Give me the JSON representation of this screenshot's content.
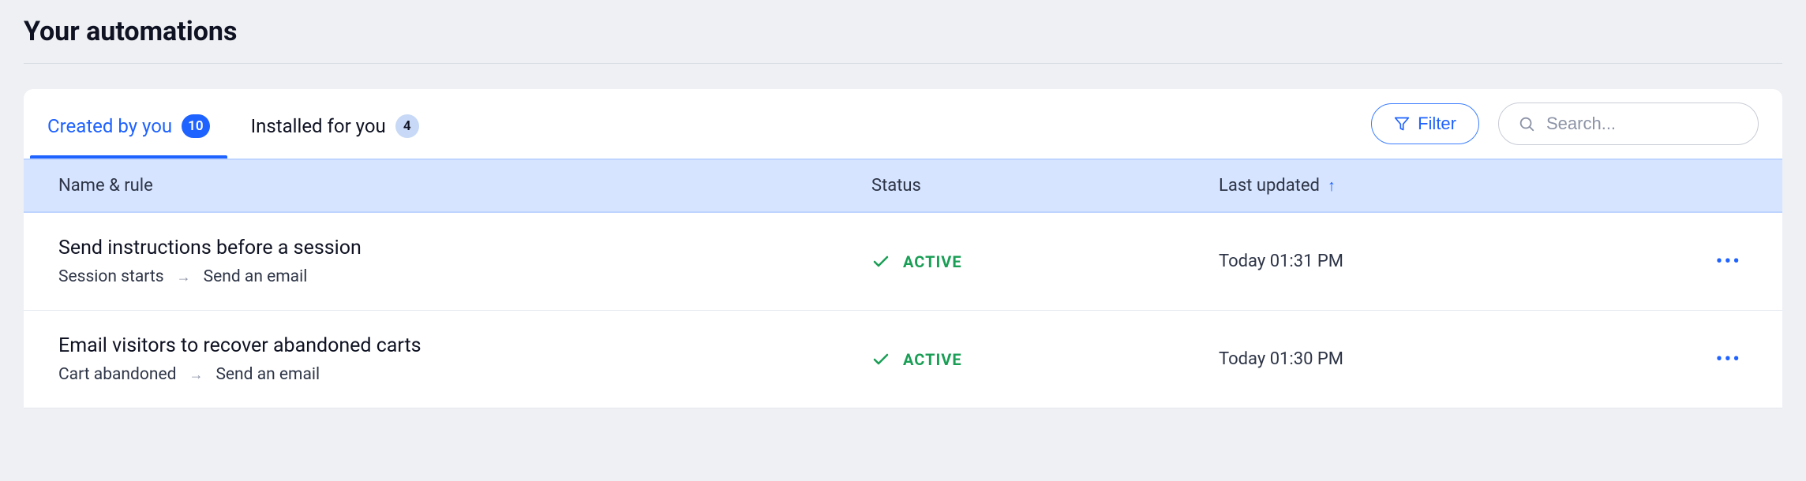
{
  "page_title": "Your automations",
  "tabs": {
    "created": {
      "label": "Created by you",
      "count": "10"
    },
    "installed": {
      "label": "Installed for you",
      "count": "4"
    }
  },
  "actions": {
    "filter_label": "Filter",
    "search_placeholder": "Search..."
  },
  "columns": {
    "name": "Name & rule",
    "status": "Status",
    "updated": "Last updated"
  },
  "rows": [
    {
      "title": "Send instructions before a session",
      "trigger": "Session starts",
      "action": "Send an email",
      "status": "ACTIVE",
      "updated": "Today 01:31 PM"
    },
    {
      "title": "Email visitors to recover abandoned carts",
      "trigger": "Cart abandoned",
      "action": "Send an email",
      "status": "ACTIVE",
      "updated": "Today 01:30 PM"
    }
  ]
}
